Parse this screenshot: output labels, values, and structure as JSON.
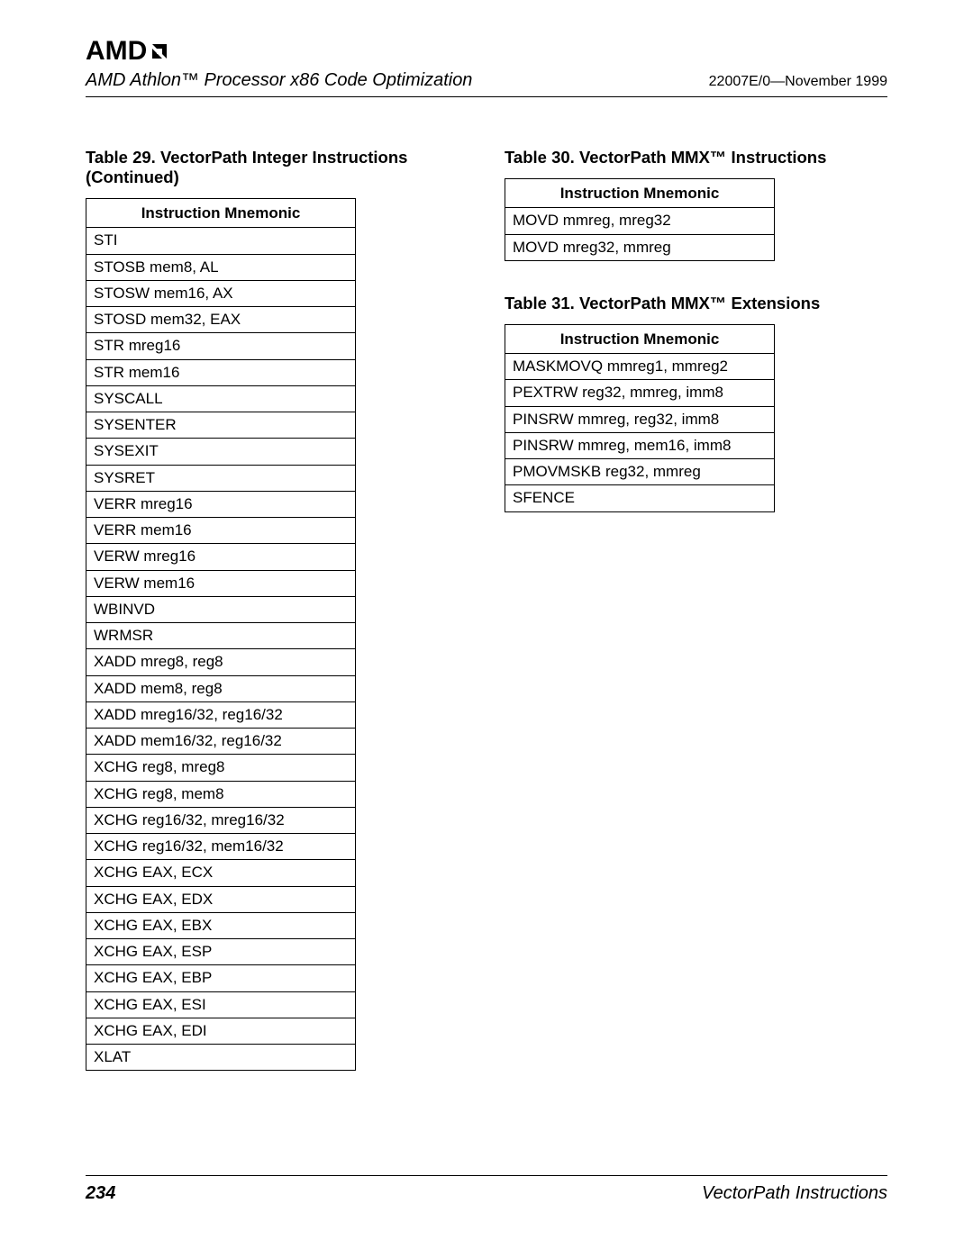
{
  "logo_text": "AMD",
  "header": {
    "title": "AMD Athlon™ Processor x86 Code Optimization",
    "doc_id": "22007E/0—November 1999"
  },
  "left": {
    "caption": "Table 29. VectorPath Integer Instructions (Continued)",
    "header_label": "Instruction Mnemonic",
    "rows": [
      "STI",
      "STOSB mem8, AL",
      "STOSW mem16, AX",
      "STOSD mem32, EAX",
      "STR mreg16",
      "STR mem16",
      "SYSCALL",
      "SYSENTER",
      "SYSEXIT",
      "SYSRET",
      "VERR mreg16",
      "VERR mem16",
      "VERW mreg16",
      "VERW mem16",
      "WBINVD",
      "WRMSR",
      "XADD mreg8, reg8",
      "XADD mem8, reg8",
      "XADD mreg16/32, reg16/32",
      "XADD mem16/32, reg16/32",
      "XCHG reg8, mreg8",
      "XCHG reg8, mem8",
      "XCHG reg16/32, mreg16/32",
      "XCHG reg16/32, mem16/32",
      "XCHG EAX, ECX",
      "XCHG EAX, EDX",
      "XCHG EAX, EBX",
      "XCHG EAX, ESP",
      "XCHG EAX, EBP",
      "XCHG EAX, ESI",
      "XCHG EAX, EDI",
      "XLAT"
    ]
  },
  "right1": {
    "caption": "Table 30. VectorPath MMX™ Instructions",
    "header_label": "Instruction Mnemonic",
    "rows": [
      "MOVD mmreg, mreg32",
      "MOVD mreg32, mmreg"
    ]
  },
  "right2": {
    "caption": "Table 31.  VectorPath MMX™ Extensions",
    "header_label": "Instruction Mnemonic",
    "rows": [
      "MASKMOVQ mmreg1, mmreg2",
      "PEXTRW reg32, mmreg, imm8",
      "PINSRW mmreg, reg32, imm8",
      "PINSRW mmreg, mem16, imm8",
      "PMOVMSKB reg32, mmreg",
      "SFENCE"
    ]
  },
  "footer": {
    "page_number": "234",
    "section": "VectorPath Instructions"
  }
}
